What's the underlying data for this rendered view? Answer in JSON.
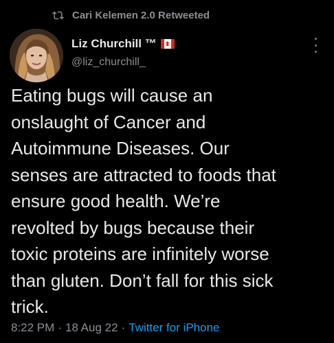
{
  "retweet": {
    "icon": "retweet-icon",
    "label": "Cari Kelemen 2.0 Retweeted"
  },
  "author": {
    "name": "Liz Churchill ™",
    "flag": "canada-flag-icon",
    "handle": "@liz_churchill_"
  },
  "tweet": {
    "text": "Eating bugs will cause an\nonslaught of Cancer and\nAutoimmune Diseases. Our\nsenses are attracted to foods that\nensure good health. We’re\nrevolted by bugs because their\ntoxic proteins are infinitely worse\nthan gluten. Don’t fall for this sick\ntrick.",
    "time": "8:22 PM",
    "separator": "·",
    "date": "18 Aug 22",
    "source": "Twitter for iPhone"
  },
  "colors": {
    "background": "#000000",
    "text": "#e7e9ea",
    "muted": "#8b9096",
    "link": "#1d9bf0"
  }
}
